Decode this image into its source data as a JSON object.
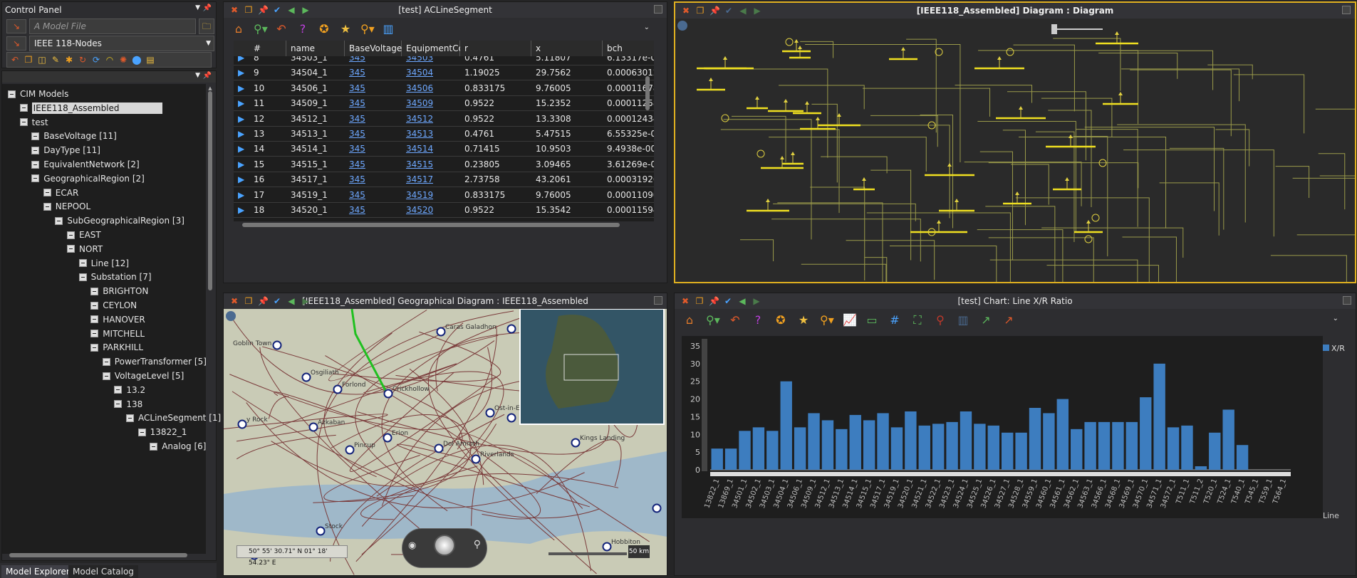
{
  "control_panel": {
    "title": "Control Panel",
    "model_file_placeholder": "A Model File",
    "model_select": "IEEE 118-Nodes"
  },
  "tree": {
    "items": [
      {
        "label": "CIM Models",
        "level": 0,
        "selected": false
      },
      {
        "label": "IEEE118_Assembled",
        "level": 1,
        "selected": true
      },
      {
        "label": "test",
        "level": 1,
        "selected": false
      },
      {
        "label": "BaseVoltage [11]",
        "level": 2,
        "selected": false
      },
      {
        "label": "DayType [11]",
        "level": 2,
        "selected": false
      },
      {
        "label": "EquivalentNetwork [2]",
        "level": 2,
        "selected": false
      },
      {
        "label": "GeographicalRegion [2]",
        "level": 2,
        "selected": false
      },
      {
        "label": "ECAR",
        "level": 3,
        "selected": false
      },
      {
        "label": "NEPOOL",
        "level": 3,
        "selected": false
      },
      {
        "label": "SubGeographicalRegion [3]",
        "level": 4,
        "selected": false
      },
      {
        "label": "EAST",
        "level": 5,
        "selected": false
      },
      {
        "label": "NORT",
        "level": 5,
        "selected": false
      },
      {
        "label": "Line [12]",
        "level": 6,
        "selected": false
      },
      {
        "label": "Substation [7]",
        "level": 6,
        "selected": false
      },
      {
        "label": "BRIGHTON",
        "level": 7,
        "selected": false
      },
      {
        "label": "CEYLON",
        "level": 7,
        "selected": false
      },
      {
        "label": "HANOVER",
        "level": 7,
        "selected": false
      },
      {
        "label": "MITCHELL",
        "level": 7,
        "selected": false
      },
      {
        "label": "PARKHILL",
        "level": 7,
        "selected": false
      },
      {
        "label": "PowerTransformer [5]",
        "level": 8,
        "selected": false
      },
      {
        "label": "VoltageLevel [5]",
        "level": 8,
        "selected": false
      },
      {
        "label": "13.2",
        "level": 9,
        "selected": false
      },
      {
        "label": "138",
        "level": 9,
        "selected": false
      },
      {
        "label": "ACLineSegment [1]",
        "level": 10,
        "selected": false
      },
      {
        "label": "13822_1",
        "level": 11,
        "selected": false
      },
      {
        "label": "Analog [6]",
        "level": 12,
        "selected": false
      }
    ]
  },
  "bottom_tabs": [
    "Model Explorer",
    "Model Catalog"
  ],
  "table_panel": {
    "title": "[test] ACLineSegment",
    "columns": [
      "#",
      "name",
      "BaseVoltage",
      "EquipmentContai",
      "r",
      "x",
      "bch"
    ],
    "rows": [
      [
        "8",
        "34503_1",
        "345",
        "34503",
        "0.4761",
        "5.11807",
        "6.13317e-005"
      ],
      [
        "9",
        "34504_1",
        "345",
        "34504",
        "1.19025",
        "29.7562",
        "0.00063012"
      ],
      [
        "10",
        "34506_1",
        "345",
        "34506",
        "0.833175",
        "9.76005",
        "0.000116782"
      ],
      [
        "11",
        "34509_1",
        "345",
        "34509",
        "0.9522",
        "15.2352",
        "0.000112581"
      ],
      [
        "12",
        "34512_1",
        "345",
        "34512",
        "0.9522",
        "13.3308",
        "0.000124344"
      ],
      [
        "13",
        "34513_1",
        "345",
        "34513",
        "0.4761",
        "5.47515",
        "6.55325e-005"
      ],
      [
        "14",
        "34514_1",
        "345",
        "34514",
        "0.71415",
        "10.9503",
        "9.4938e-005"
      ],
      [
        "15",
        "34515_1",
        "345",
        "34515",
        "0.23805",
        "3.09465",
        "3.61269e-005"
      ],
      [
        "16",
        "34517_1",
        "345",
        "34517",
        "2.73758",
        "43.2061",
        "0.000319261"
      ],
      [
        "17",
        "34519_1",
        "345",
        "34519",
        "0.833175",
        "9.76005",
        "0.000110901"
      ],
      [
        "18",
        "34520_1",
        "345",
        "34520",
        "0.9522",
        "15.3542",
        "0.000115942"
      ]
    ]
  },
  "diagram_panel": {
    "title": "[IEEE118_Assembled] Diagram : Diagram"
  },
  "map_panel": {
    "title": "[IEEE118_Assembled] Geographical Diagram : IEEE118_Assembled",
    "coords": "50° 55' 30.71\" N 01° 18' 54.23\" E",
    "scale": "50 km",
    "places": [
      "Goblin Town",
      "Caras Galadhon",
      "Osgiliath",
      "Forlond",
      "Crickhollow",
      "Azkaban",
      "Pincup",
      "Erion",
      "Dol Amroth",
      "Riverlands",
      "Ost-in-Edhil",
      "Kings Landing",
      "Stock",
      "Hobbiton",
      "Michel Delving",
      "Tangle Forest",
      "y Rock"
    ]
  },
  "chart_panel": {
    "title": "[test] Chart: Line X/R Ratio"
  },
  "chart_data": {
    "type": "bar",
    "legend": "X/R",
    "xlabel": "Line",
    "ylim": [
      0,
      35
    ],
    "yticks": [
      0,
      5,
      10,
      15,
      20,
      25,
      30,
      35
    ],
    "categories": [
      "13822_1",
      "13869_1",
      "34501_1",
      "34502_1",
      "34503_1",
      "34504_1",
      "34506_1",
      "34509_1",
      "34512_1",
      "34513_1",
      "34514_1",
      "34515_1",
      "34517_1",
      "34519_1",
      "34520_1",
      "34521_1",
      "34522_1",
      "34523_1",
      "34524_1",
      "34525_1",
      "34526_1",
      "34527_1",
      "34528_1",
      "34559_1",
      "34560_1",
      "34561_1",
      "34562_1",
      "34563_1",
      "34566_1",
      "34568_1",
      "34569_1",
      "34570_1",
      "34571_1",
      "34572_1",
      "T511_1",
      "T511_2",
      "T520_1",
      "T524_1",
      "T540_1",
      "T545_1",
      "T559_1",
      "T564_1"
    ],
    "values": [
      6,
      6,
      11,
      12,
      11,
      25,
      12,
      16,
      14,
      11.5,
      15.5,
      14,
      16,
      12,
      16.5,
      12.5,
      13,
      13.5,
      16.5,
      13,
      12.5,
      10.5,
      10.5,
      17.5,
      16,
      20,
      11.5,
      13.5,
      13.5,
      13.5,
      13.5,
      20.5,
      30,
      12,
      12.5,
      1,
      10.5,
      17,
      7
    ]
  }
}
